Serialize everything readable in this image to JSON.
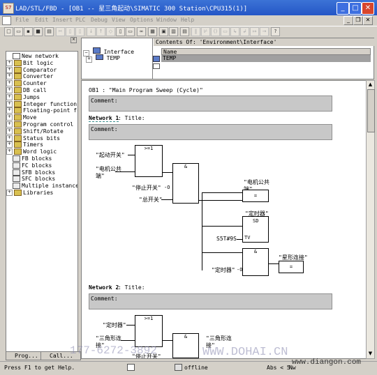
{
  "window": {
    "title": "LAD/STL/FBD  - [OB1 -- 星三角起动\\SIMATIC 300 Station\\CPU315(1)]",
    "app_icon_text": "S7"
  },
  "menu": [
    "File",
    "Edit",
    "Insert",
    "PLC",
    "Debug",
    "View",
    "Options",
    "Window",
    "Help"
  ],
  "tree": [
    {
      "label": "New network",
      "icon": "new-icon",
      "expander": ""
    },
    {
      "label": "Bit logic",
      "icon": "folder-icon",
      "expander": "+"
    },
    {
      "label": "Comparator",
      "icon": "folder-icon",
      "expander": "+"
    },
    {
      "label": "Converter",
      "icon": "folder-icon",
      "expander": "+"
    },
    {
      "label": "Counter",
      "icon": "folder-icon",
      "expander": "+"
    },
    {
      "label": "DB call",
      "icon": "folder-icon",
      "expander": "+"
    },
    {
      "label": "Jumps",
      "icon": "folder-icon",
      "expander": "+"
    },
    {
      "label": "Integer function",
      "icon": "folder-icon",
      "expander": "+"
    },
    {
      "label": "Floating-point fc",
      "icon": "folder-icon",
      "expander": "+"
    },
    {
      "label": "Move",
      "icon": "folder-icon",
      "expander": "+"
    },
    {
      "label": "Program control",
      "icon": "folder-icon",
      "expander": "+"
    },
    {
      "label": "Shift/Rotate",
      "icon": "folder-icon",
      "expander": "+"
    },
    {
      "label": "Status bits",
      "icon": "folder-icon",
      "expander": "+"
    },
    {
      "label": "Timers",
      "icon": "folder-icon",
      "expander": "+"
    },
    {
      "label": "Word logic",
      "icon": "folder-icon",
      "expander": "+"
    },
    {
      "label": "FB blocks",
      "icon": "block-icon",
      "expander": ""
    },
    {
      "label": "FC blocks",
      "icon": "block-icon",
      "expander": ""
    },
    {
      "label": "SFB blocks",
      "icon": "block-icon",
      "expander": ""
    },
    {
      "label": "SFC blocks",
      "icon": "block-icon",
      "expander": ""
    },
    {
      "label": "Multiple instance",
      "icon": "block-icon",
      "expander": ""
    },
    {
      "label": "Libraries",
      "icon": "folder-icon",
      "expander": "+"
    }
  ],
  "left_tabs": [
    "Prog...",
    "Call..."
  ],
  "interface": {
    "tree_root": "Interface",
    "tree_child": "TEMP",
    "contents_header": "Contents Of: 'Environment\\Interface'",
    "column_name": "Name",
    "row1": "TEMP"
  },
  "code": {
    "ob_header": "OB1 :   \"Main Program Sweep (Cycle)\"",
    "comment_label": "Comment:",
    "network1_label": "Network 1",
    "network1_title": ": Title:",
    "network1_comment": "Comment:",
    "n1": {
      "in_start": "\"起动开关\"",
      "in_motor1": "\"电机公共",
      "in_motor2": "端\"",
      "in_stop": "\"停止开关\"",
      "in_main": "\"总开关\"",
      "or_label": ">=1",
      "and_label": "&",
      "out_motor1": "\"电机公共",
      "out_motor2": "端\"",
      "assign": "=",
      "timer_label": "\"定时器\"",
      "sd": "SD",
      "tv": "TV",
      "s5t": "S5T#9S",
      "and2": "&",
      "star1": "\"星形连接\"",
      "timer_in": "\"定时器\"",
      "assign2": "="
    },
    "network2_label": "Network 2",
    "network2_title": ": Title:",
    "network2_comment": "Comment:",
    "n2": {
      "or_label": ">=1",
      "in_timer": "\"定时器\"",
      "in_delta1": "\"三角形连",
      "in_delta2": "接\"",
      "and_label": "&",
      "out_delta1": "\"三角形连",
      "out_delta2": "接\"",
      "in_stop": "\"停止开关\""
    }
  },
  "status": {
    "help": "Press F1 to get Help.",
    "mode": "offline",
    "abs": "Abs < 5.",
    "num": "Nw"
  },
  "watermarks": {
    "dohai": "WWW.DOHAI.CN",
    "diangon": "www.diangon.com",
    "phone": "177-6272-3892"
  }
}
